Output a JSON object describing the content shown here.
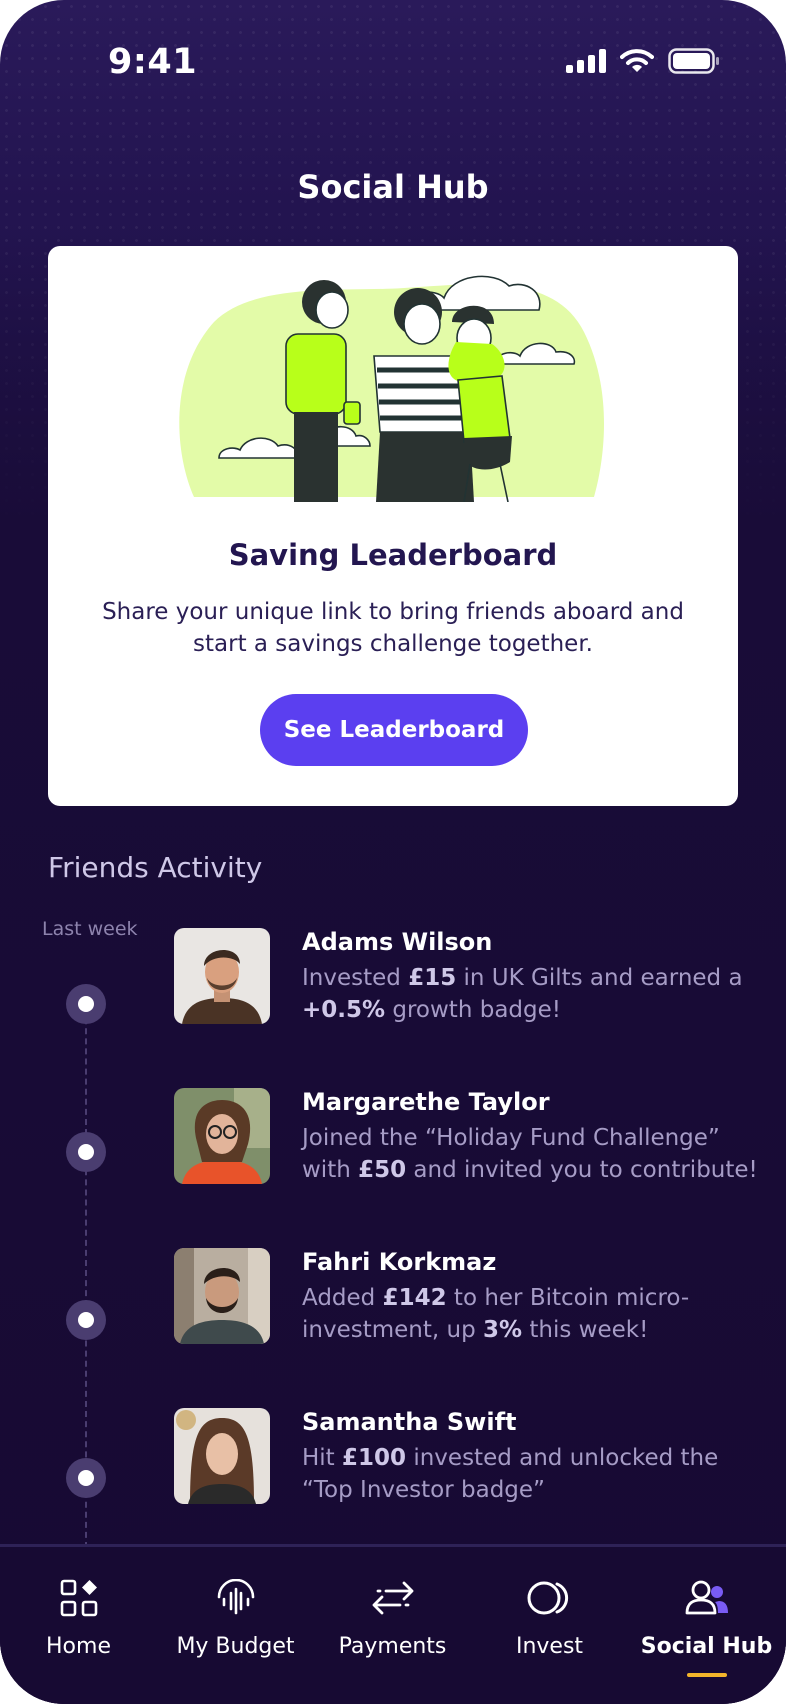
{
  "status_bar": {
    "time": "9:41"
  },
  "header": {
    "title": "Social Hub"
  },
  "promo_card": {
    "title": "Saving Leaderboard",
    "description": "Share your unique link to bring friends aboard and start a savings challenge together.",
    "button_label": "See Leaderboard"
  },
  "friends_activity": {
    "title": "Friends Activity",
    "period_label": "Last week",
    "items": [
      {
        "name": "Adams Wilson",
        "parts": [
          "Invested ",
          "£15",
          " in UK Gilts and earned a ",
          "+0.5%",
          " growth badge!"
        ]
      },
      {
        "name": "Margarethe Taylor",
        "parts": [
          "Joined the “Holiday Fund Challenge” with ",
          "£50",
          " and invited you to contribute!"
        ]
      },
      {
        "name": "Fahri Korkmaz",
        "parts": [
          "Added ",
          "£142",
          " to her Bitcoin micro-investment, up ",
          "3%",
          " this week!"
        ]
      },
      {
        "name": "Samantha Swift",
        "parts": [
          "Hit ",
          "£100",
          " invested and unlocked the “Top Investor badge”"
        ]
      }
    ]
  },
  "bottom_nav": {
    "items": [
      {
        "label": "Home",
        "icon": "home-grid-icon"
      },
      {
        "label": "My Budget",
        "icon": "budget-icon"
      },
      {
        "label": "Payments",
        "icon": "transfer-arrows-icon"
      },
      {
        "label": "Invest",
        "icon": "invest-icon"
      },
      {
        "label": "Social Hub",
        "icon": "people-icon",
        "active": true
      }
    ]
  },
  "colors": {
    "background": "#1a0d3c",
    "accent": "#5b3ff0",
    "illustration_highlight": "#b8ff1a",
    "nav_indicator": "#f3b52b"
  }
}
